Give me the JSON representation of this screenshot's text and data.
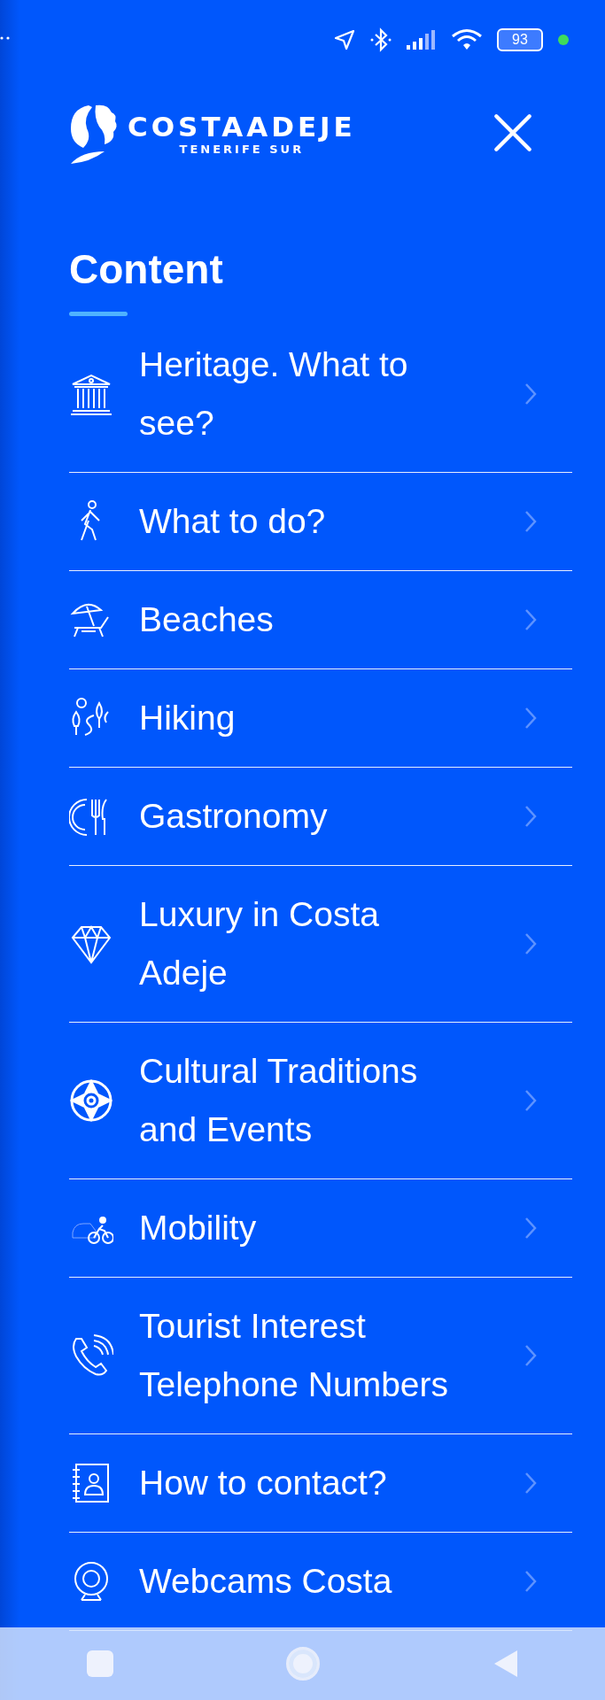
{
  "status_bar": {
    "battery": "93"
  },
  "header": {
    "logo_title": "COSTAADEJE",
    "logo_subtitle": "TENERIFE SUR"
  },
  "section": {
    "title": "Content"
  },
  "menu": [
    {
      "label": "Heritage. What to see?"
    },
    {
      "label": "What to do?"
    },
    {
      "label": "Beaches"
    },
    {
      "label": "Hiking"
    },
    {
      "label": "Gastronomy"
    },
    {
      "label": "Luxury in Costa Adeje"
    },
    {
      "label": "Cultural Traditions and Events"
    },
    {
      "label": "Mobility"
    },
    {
      "label": "Tourist Interest Telephone Numbers"
    },
    {
      "label": "How to contact?"
    },
    {
      "label": "Webcams Costa"
    }
  ]
}
